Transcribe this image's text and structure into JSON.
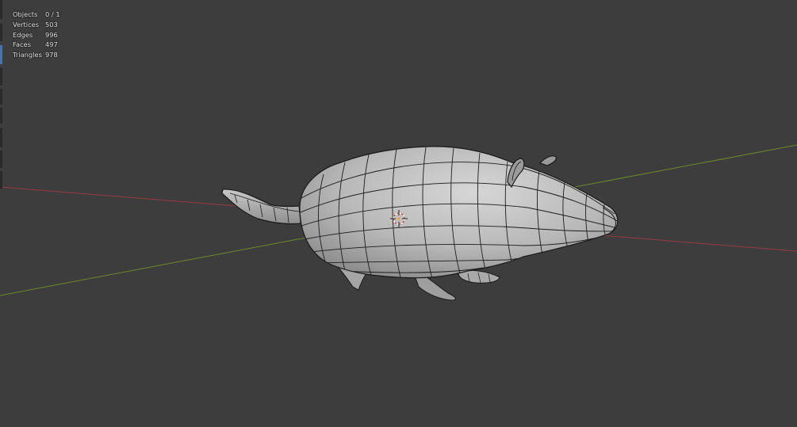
{
  "stats": {
    "rows": [
      {
        "label": "Objects",
        "value": "0 / 1"
      },
      {
        "label": "Vertices",
        "value": "503"
      },
      {
        "label": "Edges",
        "value": "996"
      },
      {
        "label": "Faces",
        "value": "497"
      },
      {
        "label": "Triangles",
        "value": "978"
      }
    ]
  },
  "colors": {
    "background": "#3d3d3d",
    "x_axis": "#9a3a3f",
    "y_axis": "#6b8a2c",
    "mesh_fill": "#b9b9b9",
    "wire": "#1a1a1a",
    "toolbar_active": "#4772b3"
  },
  "icons": [
    "3d-cursor-icon",
    "object-origin-icon"
  ]
}
